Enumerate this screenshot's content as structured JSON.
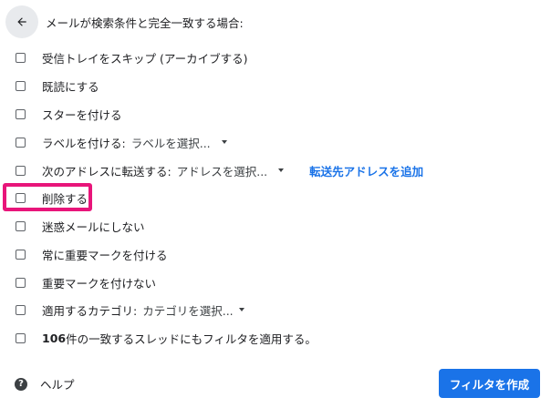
{
  "header": {
    "title": "メールが検索条件と完全一致する場合:",
    "back_icon": "arrow-back-icon"
  },
  "options": [
    {
      "label": "受信トレイをスキップ (アーカイブする)",
      "checked": false
    },
    {
      "label": "既読にする",
      "checked": false
    },
    {
      "label": "スターを付ける",
      "checked": false
    },
    {
      "label": "ラベルを付ける:",
      "checked": false,
      "dropdown": "ラベルを選択..."
    },
    {
      "label": "次のアドレスに転送する:",
      "checked": false,
      "dropdown": "アドレスを選択...",
      "link": "転送先アドレスを追加"
    },
    {
      "label": "削除する",
      "checked": false
    },
    {
      "label": "迷惑メールにしない",
      "checked": false
    },
    {
      "label": "常に重要マークを付ける",
      "checked": false
    },
    {
      "label": "重要マークを付けない",
      "checked": false
    },
    {
      "label": "適用するカテゴリ:",
      "checked": false,
      "dropdown": "カテゴリを選択..."
    },
    {
      "label_count": "106",
      "label": " 件の一致するスレッドにもフィルタを適用する。",
      "checked": false
    }
  ],
  "footer": {
    "help_label": "ヘルプ",
    "help_icon": "help-circle-icon",
    "create_button": "フィルタを作成"
  },
  "colors": {
    "accent": "#1a73e8",
    "highlight": "#e8157a"
  }
}
